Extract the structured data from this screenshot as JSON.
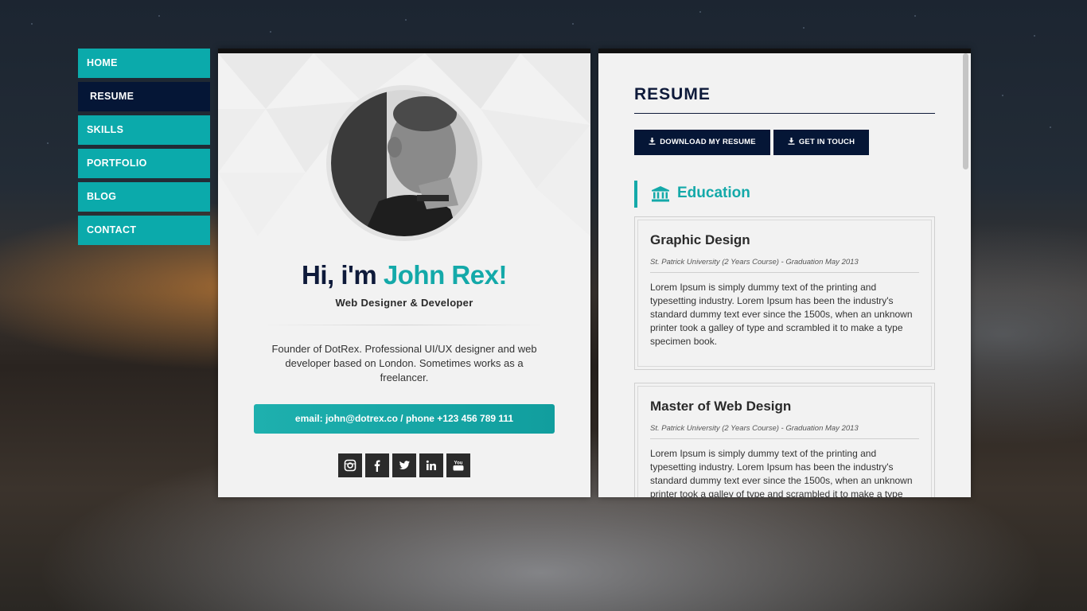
{
  "nav": {
    "items": [
      {
        "label": "HOME",
        "active": false
      },
      {
        "label": "RESUME",
        "active": true
      },
      {
        "label": "SKILLS",
        "active": false
      },
      {
        "label": "PORTFOLIO",
        "active": false
      },
      {
        "label": "BLOG",
        "active": false
      },
      {
        "label": "CONTACT",
        "active": false
      }
    ]
  },
  "profile": {
    "greeting_prefix": "Hi, i'm ",
    "name": "John Rex!",
    "subtitle": "Web Designer & Developer",
    "bio": "Founder of DotRex. Professional UI/UX designer and web developer based on London. Sometimes works as a freelancer.",
    "contact": "email: john@dotrex.co / phone +123 456 789 111",
    "socials": [
      "instagram-icon",
      "facebook-icon",
      "twitter-icon",
      "linkedin-icon",
      "youtube-icon"
    ]
  },
  "resume": {
    "title": "RESUME",
    "download_label": "DOWNLOAD MY RESUME",
    "contact_label": "GET IN TOUCH",
    "education_title": "Education",
    "entries": [
      {
        "title": "Graphic Design",
        "meta": "St. Patrick University (2 Years Course) - Graduation May 2013",
        "text": "Lorem Ipsum is simply dummy text of the printing and typesetting industry. Lorem Ipsum has been the industry's standard dummy text ever since the 1500s, when an unknown printer took a galley of type and scrambled it to make a type specimen book."
      },
      {
        "title": "Master of Web Design",
        "meta": "St. Patrick University (2 Years Course) - Graduation May 2013",
        "text": "Lorem Ipsum is simply dummy text of the printing and typesetting industry. Lorem Ipsum has been the industry's standard dummy text ever since the 1500s, when an unknown printer took a galley of type and scrambled it to make a type specimen book."
      }
    ]
  },
  "colors": {
    "accent": "#14a9a9",
    "nav": "#0baaab",
    "dark": "#051636"
  }
}
